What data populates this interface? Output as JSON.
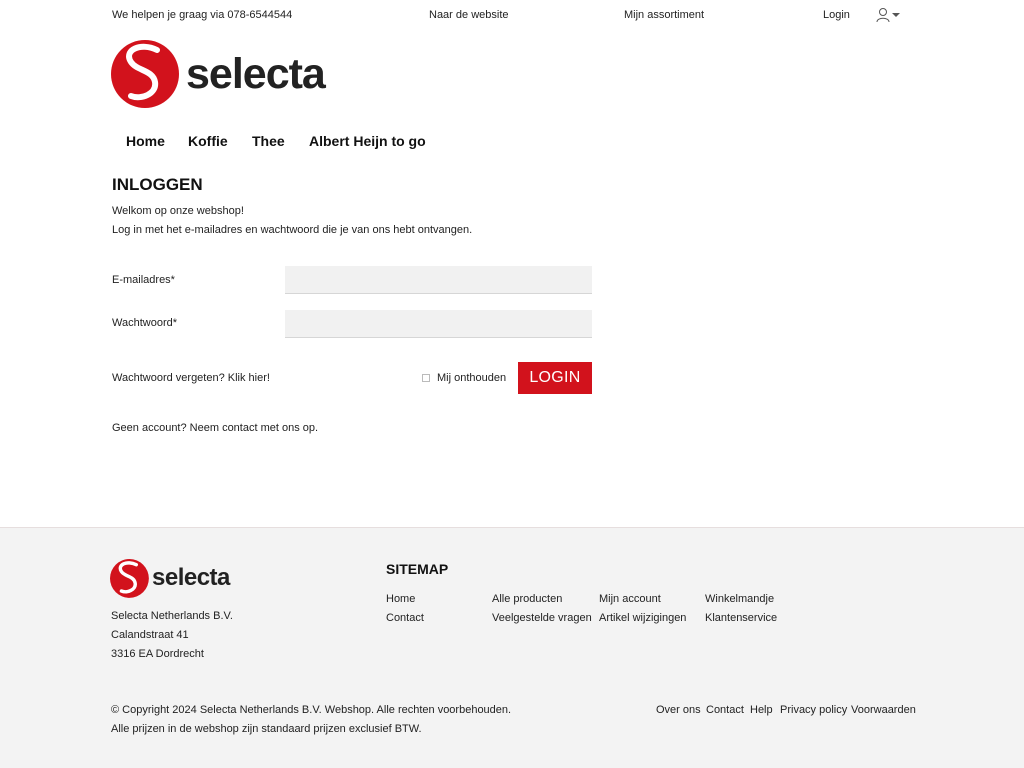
{
  "topbar": {
    "help_text": "We helpen je graag via 078-6544544",
    "website_link": "Naar de website",
    "assortment_link": "Mijn assortiment",
    "login_link": "Login"
  },
  "brand": {
    "name": "selecta",
    "color": "#d2121c"
  },
  "nav": {
    "items": [
      {
        "label": "Home"
      },
      {
        "label": "Koffie"
      },
      {
        "label": "Thee"
      },
      {
        "label": "Albert Heijn to go"
      }
    ]
  },
  "login": {
    "title": "INLOGGEN",
    "intro_line1": "Welkom op onze webshop!",
    "intro_line2": "Log in met het e-mailadres en wachtwoord die je van ons hebt ontvangen.",
    "email_label": "E-mailadres*",
    "email_value": "",
    "password_label": "Wachtwoord*",
    "password_value": "",
    "forgot_link": "Wachtwoord vergeten? Klik hier!",
    "remember_label": "Mij onthouden",
    "remember_checked": false,
    "submit_label": "LOGIN",
    "no_account_text": "Geen account? Neem contact met ons op."
  },
  "footer": {
    "company": "Selecta Netherlands B.V.",
    "street": "Calandstraat 41",
    "city": "3316 EA Dordrecht",
    "sitemap_title": "SITEMAP",
    "sitemap": [
      {
        "label": "Home"
      },
      {
        "label": "Alle producten"
      },
      {
        "label": "Mijn account"
      },
      {
        "label": "Winkelmandje"
      },
      {
        "label": "Contact"
      },
      {
        "label": "Veelgestelde vragen"
      },
      {
        "label": "Artikel wijzigingen"
      },
      {
        "label": "Klantenservice"
      }
    ],
    "copyright": "© Copyright 2024 Selecta Netherlands B.V. Webshop. Alle rechten voorbehouden.",
    "prices_note": "Alle prijzen in de webshop zijn standaard prijzen exclusief BTW.",
    "links": [
      {
        "label": "Over ons"
      },
      {
        "label": "Contact"
      },
      {
        "label": "Help"
      },
      {
        "label": "Privacy policy"
      },
      {
        "label": "Voorwaarden"
      }
    ]
  }
}
